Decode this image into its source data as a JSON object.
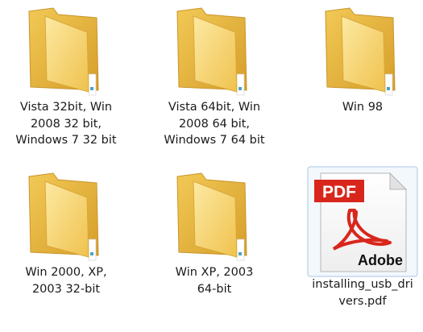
{
  "items": [
    {
      "label": "Vista 32bit, Win\n2008 32 bit,\nWindows 7 32 bit",
      "icon": "folder-icon"
    },
    {
      "label": "Vista 64bit, Win\n2008 64 bit,\nWindows 7 64 bit",
      "icon": "folder-icon"
    },
    {
      "label": "Win 98",
      "icon": "folder-icon"
    },
    {
      "label": "Win 2000, XP,\n2003 32-bit",
      "icon": "folder-icon"
    },
    {
      "label": "Win XP, 2003\n64-bit",
      "icon": "folder-icon"
    },
    {
      "label": "installing_usb_dri\nvers.pdf",
      "icon": "pdf-file-icon",
      "badge": "PDF",
      "brand": "Adobe"
    }
  ],
  "colors": {
    "folder_back": "#e8b73f",
    "folder_front": "#f8d56a",
    "pdf_red": "#d9261c"
  }
}
